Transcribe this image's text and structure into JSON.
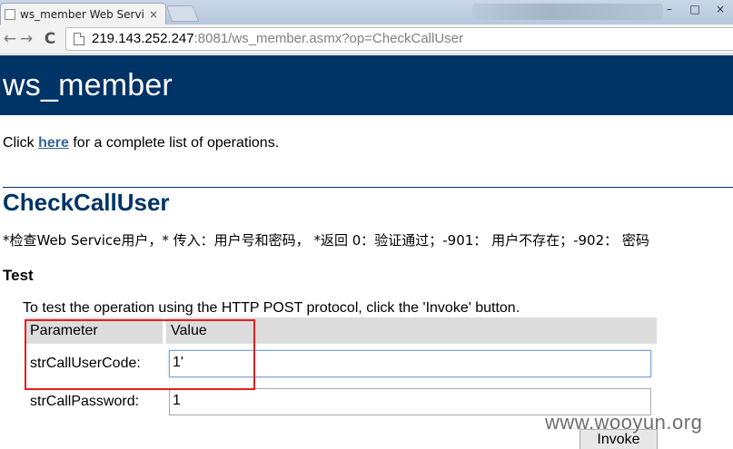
{
  "browser": {
    "active_tab_title": "ws_member Web Servic",
    "tab_close": "×",
    "url_host": "219.143.252.247",
    "url_rest": ":8081/ws_member.asmx?op=CheckCallUser",
    "nav": {
      "back": "←",
      "forward": "→",
      "reload": "C"
    },
    "window_controls": {
      "minimize": "–",
      "maximize": "□",
      "close": "×"
    }
  },
  "page": {
    "service_title": "ws_member",
    "intro": {
      "prefix": "Click ",
      "link": "here",
      "suffix": " for a complete list of operations."
    },
    "operation_title": "CheckCallUser",
    "operation_description": "*检查Web Service用户，* 传入：用户号和密码， *返回 0：验证通过；-901： 用户不存在；-902： 密码",
    "test_heading": "Test",
    "test_instructions": "To test the operation using the HTTP POST protocol, click the 'Invoke' button.",
    "form": {
      "header_parameter": "Parameter",
      "header_value": "Value",
      "params": [
        {
          "label": "strCallUserCode:",
          "value": "1'"
        },
        {
          "label": "strCallPassword:",
          "value": "1"
        }
      ],
      "invoke_label": "Invoke"
    }
  },
  "watermark": "www.wooyun.org",
  "colors": {
    "banner": "#003366",
    "link": "#336699",
    "highlight": "#e02020"
  }
}
